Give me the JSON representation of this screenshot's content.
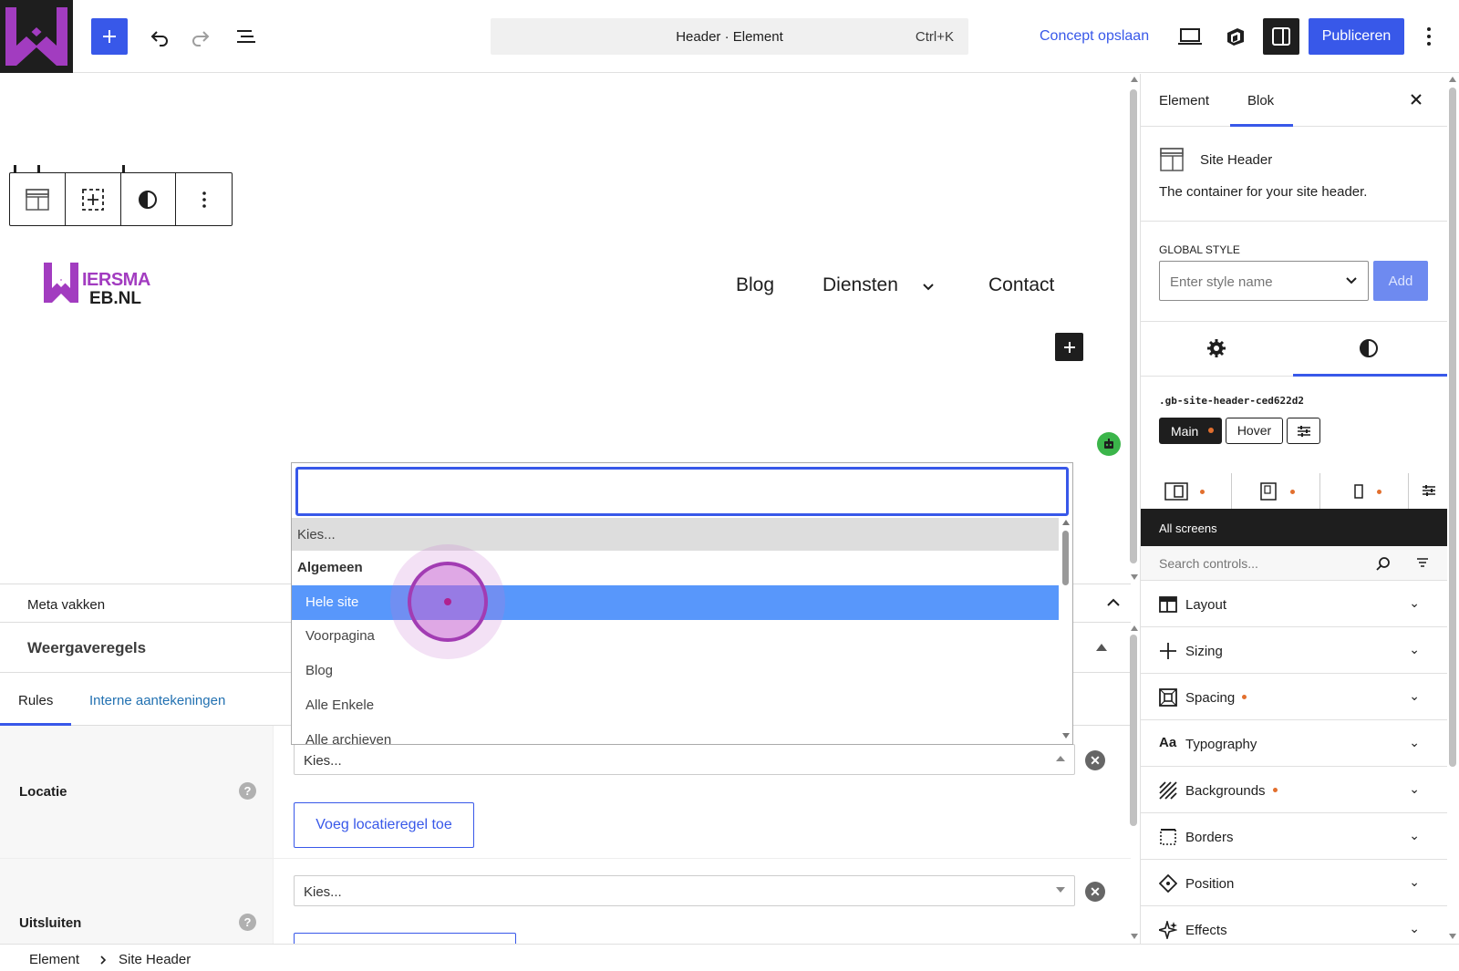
{
  "topbar": {
    "command_title": "Header · Element",
    "command_shortcut": "Ctrl+K",
    "save_draft": "Concept opslaan",
    "publish": "Publiceren"
  },
  "canvas": {
    "logo_line1": "IERSMA",
    "logo_line2": "EB.NL",
    "nav": [
      "Blog",
      "Diensten",
      "Contact"
    ]
  },
  "meta": {
    "header": "Meta vakken",
    "section_title": "Weergaveregels",
    "tabs": [
      "Rules",
      "Interne aantekeningen"
    ],
    "location_label": "Locatie",
    "location_select": "Kies...",
    "add_location_button": "Voeg locatieregel toe",
    "exclude_label": "Uitsluiten",
    "exclude_select": "Kies...",
    "help_glyph": "?"
  },
  "dropdown": {
    "search_value": "",
    "placeholder_option": "Kies...",
    "group_label": "Algemeen",
    "options": [
      "Hele site",
      "Voorpagina",
      "Blog",
      "Alle Enkele",
      "Alle archieven"
    ],
    "highlighted_index": 0
  },
  "sidebar": {
    "tabs": [
      "Element",
      "Blok"
    ],
    "active_tab": "Blok",
    "block_title": "Site Header",
    "block_desc": "The container for your site header.",
    "global_style_label": "GLOBAL STYLE",
    "style_name_placeholder": "Enter style name",
    "add_button": "Add",
    "css_class": ".gb-site-header-ced622d2",
    "state_main": "Main",
    "state_hover": "Hover",
    "screens_label": "All screens",
    "search_placeholder": "Search controls...",
    "panels": [
      {
        "label": "Layout",
        "dot": false,
        "icon": "layout-icon"
      },
      {
        "label": "Sizing",
        "dot": false,
        "icon": "sizing-icon"
      },
      {
        "label": "Spacing",
        "dot": true,
        "icon": "spacing-icon"
      },
      {
        "label": "Typography",
        "dot": false,
        "icon": "typography-icon"
      },
      {
        "label": "Backgrounds",
        "dot": true,
        "icon": "backgrounds-icon"
      },
      {
        "label": "Borders",
        "dot": false,
        "icon": "borders-icon"
      },
      {
        "label": "Position",
        "dot": false,
        "icon": "position-icon"
      },
      {
        "label": "Effects",
        "dot": false,
        "icon": "effects-icon"
      }
    ],
    "typography_glyph": "Aa"
  },
  "footer": {
    "breadcrumb": [
      "Element",
      "Site Header"
    ]
  },
  "colors": {
    "accent": "#3858e9",
    "dark": "#1e1e1e",
    "highlight": "#5897fb",
    "dot": "#e26f2e",
    "logo": "#a23cc0"
  }
}
